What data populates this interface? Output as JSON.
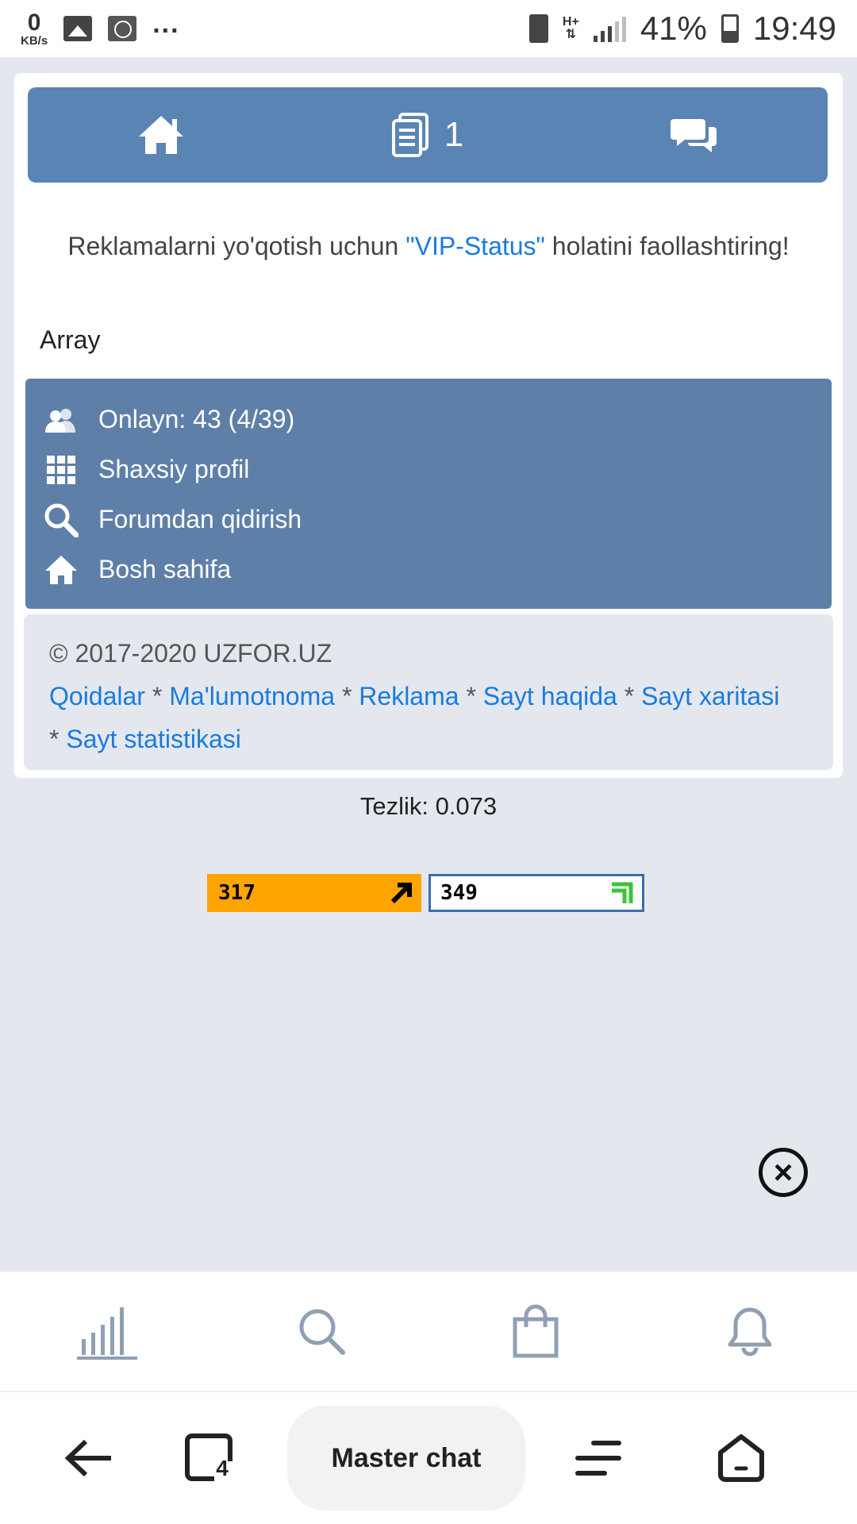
{
  "status_bar": {
    "net_speed": "0",
    "net_unit": "KB/s",
    "more": "...",
    "network_type": "H+",
    "battery": "41%",
    "time": "19:49"
  },
  "top_nav": {
    "home_icon": "home-icon",
    "docs_icon": "document-icon",
    "docs_count": "1",
    "chat_icon": "chat-icon"
  },
  "vip": {
    "before": "Reklamalarni yo'qotish uchun ",
    "link": "\"VIP-Status\"",
    "after": " holatini faollashtiring!"
  },
  "array_text": "Array",
  "menu": [
    {
      "icon": "users-icon",
      "label": "Onlayn: 43 (4/39)"
    },
    {
      "icon": "grid-icon",
      "label": "Shaxsiy profil"
    },
    {
      "icon": "search-icon",
      "label": "Forumdan qidirish"
    },
    {
      "icon": "home-icon",
      "label": "Bosh sahifa"
    }
  ],
  "footer": {
    "copyright": "© 2017-2020 UZFOR.UZ",
    "links": [
      "Qoidalar",
      "Ma'lumotnoma",
      "Reklama",
      "Sayt haqida",
      "Sayt xaritasi",
      "Sayt statistikasi"
    ],
    "separator": " * "
  },
  "speed": "Tezlik: 0.073",
  "counters": {
    "first": "317",
    "second": "349"
  },
  "colors": {
    "nav_blue": "#5a84b4",
    "menu_blue": "#5e7fa8",
    "link_blue": "#1a7ae0",
    "counter_orange": "#ffa500",
    "page_bg": "#e4e8ee"
  },
  "bottom_toolbar": [
    "stats-icon",
    "search-icon",
    "shopping-bag-icon",
    "bell-icon"
  ],
  "system_nav": {
    "back": "back-arrow-icon",
    "tabs": "tabs-icon",
    "tabs_count": "4",
    "center_label": "Master chat",
    "menu": "menu-icon",
    "home": "home-outline-icon"
  }
}
